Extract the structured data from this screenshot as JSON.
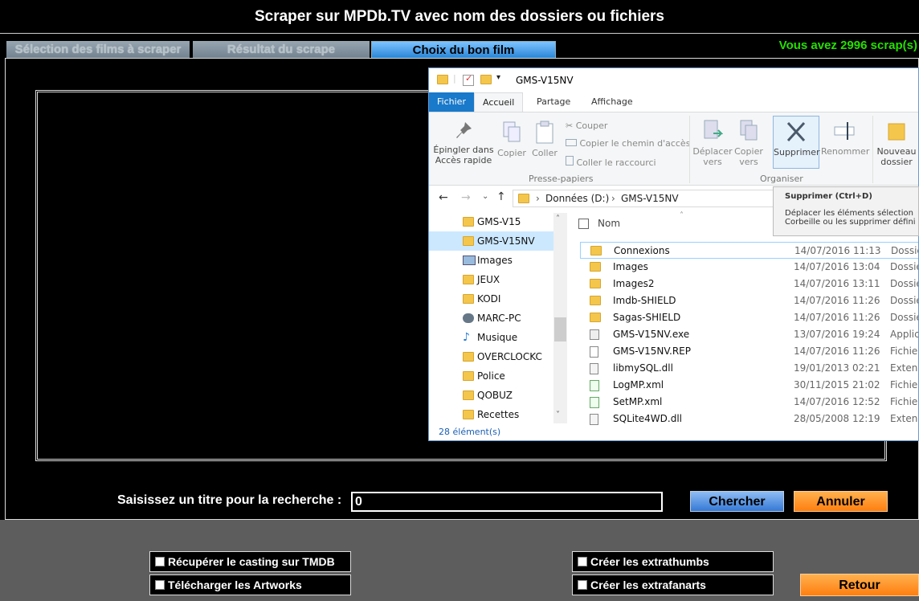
{
  "app": {
    "title": "Scraper sur MPDb.TV avec nom des dossiers ou fichiers",
    "tabs": [
      {
        "label": "Sélection des films à scraper",
        "active": false
      },
      {
        "label": "Résultat du scrape",
        "active": false
      },
      {
        "label": "Choix du bon film",
        "active": true
      }
    ],
    "scrap_count": "Vous avez 2996 scrap(s)",
    "search_label": "Saisissez un titre pour la recherche :",
    "search_value": "0",
    "search_button": "Chercher",
    "cancel_button": "Annuler",
    "back_button": "Retour",
    "checkboxes": [
      {
        "label": "Récupérer le casting sur TMDB",
        "checked": false
      },
      {
        "label": "Télécharger les Artworks",
        "checked": false
      },
      {
        "label": "Créer les extrathumbs",
        "checked": false
      },
      {
        "label": "Créer les extrafanarts",
        "checked": false
      }
    ],
    "colors": {
      "accent_green": "#25e000",
      "button_blue": "#3478d6",
      "button_orange": "#ff7e0f"
    }
  },
  "explorer": {
    "window_title": "GMS-V15NV",
    "ribbon_tabs": [
      "Fichier",
      "Accueil",
      "Partage",
      "Affichage"
    ],
    "ribbon": {
      "pin": "Épingler dans Accès rapide",
      "copy": "Copier",
      "paste": "Coller",
      "cut": "Couper",
      "copy_path": "Copier le chemin d'accès",
      "paste_shortcut": "Coller le raccourci",
      "clipboard_group": "Presse-papiers",
      "move_to": "Déplacer vers",
      "copy_to": "Copier vers",
      "delete": "Supprimer",
      "rename": "Renommer",
      "organize_group": "Organiser",
      "new_folder": "Nouveau dossier"
    },
    "address": [
      "Données (D:)",
      "GMS-V15NV"
    ],
    "tooltip": {
      "title": "Supprimer (Ctrl+D)",
      "line1": "Déplacer les éléments sélection",
      "line2": "Corbeille ou les supprimer défini"
    },
    "tree": [
      {
        "label": "GMS-V15",
        "icon": "folder-icon",
        "selected": false
      },
      {
        "label": "GMS-V15NV",
        "icon": "folder-icon",
        "selected": true
      },
      {
        "label": "Images",
        "icon": "pictures-icon",
        "selected": false
      },
      {
        "label": "JEUX",
        "icon": "folder-icon",
        "selected": false
      },
      {
        "label": "KODI",
        "icon": "folder-icon",
        "selected": false
      },
      {
        "label": "MARC-PC",
        "icon": "network-pc-icon",
        "selected": false
      },
      {
        "label": "Musique",
        "icon": "music-icon",
        "selected": false
      },
      {
        "label": "OVERCLOCKC",
        "icon": "folder-icon",
        "selected": false
      },
      {
        "label": "Police",
        "icon": "folder-icon",
        "selected": false
      },
      {
        "label": "QOBUZ",
        "icon": "folder-icon",
        "selected": false
      },
      {
        "label": "Recettes",
        "icon": "folder-icon",
        "selected": false
      }
    ],
    "column_name": "Nom",
    "files": [
      {
        "name": "Connexions",
        "date": "14/07/2016 11:13",
        "type": "Dossier",
        "icon": "folder-icon"
      },
      {
        "name": "Images",
        "date": "14/07/2016 13:04",
        "type": "Dossier",
        "icon": "folder-icon"
      },
      {
        "name": "Images2",
        "date": "14/07/2016 13:11",
        "type": "Dossier",
        "icon": "folder-icon"
      },
      {
        "name": "Imdb-SHIELD",
        "date": "14/07/2016 11:26",
        "type": "Dossier",
        "icon": "folder-icon"
      },
      {
        "name": "Sagas-SHIELD",
        "date": "14/07/2016 11:26",
        "type": "Dossier",
        "icon": "folder-icon"
      },
      {
        "name": "GMS-V15NV.exe",
        "date": "13/07/2016 19:24",
        "type": "Applica",
        "icon": "exe-icon"
      },
      {
        "name": "GMS-V15NV.REP",
        "date": "14/07/2016 11:26",
        "type": "Fichier",
        "icon": "file-icon"
      },
      {
        "name": "libmySQL.dll",
        "date": "19/01/2013 02:21",
        "type": "Extensi",
        "icon": "dll-icon"
      },
      {
        "name": "LogMP.xml",
        "date": "30/11/2015 21:02",
        "type": "Fichier",
        "icon": "xml-icon"
      },
      {
        "name": "SetMP.xml",
        "date": "14/07/2016 12:52",
        "type": "Fichier",
        "icon": "xml-icon"
      },
      {
        "name": "SQLite4WD.dll",
        "date": "28/05/2008 12:19",
        "type": "Extensi",
        "icon": "dll-icon"
      }
    ],
    "status": "28 élément(s)"
  }
}
